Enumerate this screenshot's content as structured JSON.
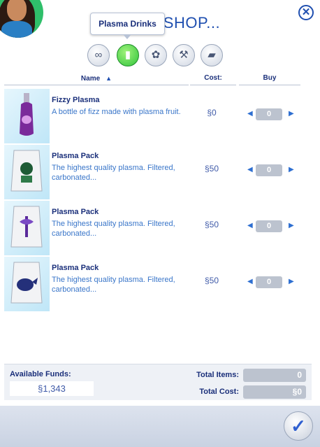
{
  "header": {
    "title": "E SHOP...",
    "tooltip": "Plasma Drinks",
    "close_icon": "close-icon"
  },
  "categories": [
    {
      "icon": "infinity-icon",
      "glyph": "∞",
      "active": false
    },
    {
      "icon": "drink-cup-icon",
      "glyph": "▮",
      "active": true
    },
    {
      "icon": "seeds-icon",
      "glyph": "✿",
      "active": false
    },
    {
      "icon": "garden-tools-icon",
      "glyph": "⚒",
      "active": false
    },
    {
      "icon": "book-icon",
      "glyph": "▰",
      "active": false
    }
  ],
  "columns": {
    "name": "Name",
    "cost": "Cost:",
    "buy": "Buy",
    "sort_icon": "sort-up-icon"
  },
  "items": [
    {
      "name": "Fizzy Plasma",
      "desc": "A bottle of fizz made with plasma fruit.",
      "price": "§0",
      "qty": "0",
      "icon": "fizzy-plasma-bottle-icon"
    },
    {
      "name": "Plasma Pack",
      "desc": "The highest quality plasma. Filtered, carbonated...",
      "price": "§50",
      "qty": "0",
      "icon": "plasma-pack-green-icon"
    },
    {
      "name": "Plasma Pack",
      "desc": "The highest quality plasma. Filtered, carbonated...",
      "price": "§50",
      "qty": "0",
      "icon": "plasma-pack-purple-icon"
    },
    {
      "name": "Plasma Pack",
      "desc": "The highest quality plasma. Filtered, carbonated...",
      "price": "§50",
      "qty": "0",
      "icon": "plasma-pack-blue-icon"
    }
  ],
  "footer": {
    "funds_label": "Available Funds:",
    "funds_value": "§1,343",
    "total_items_label": "Total Items:",
    "total_items_value": "0",
    "total_cost_label": "Total Cost:",
    "total_cost_value": "§0"
  },
  "confirm_icon": "checkmark-icon",
  "colors": {
    "accent": "#1f4fb0",
    "active_category": "#31c43c",
    "qty_box": "#bcc3cf"
  }
}
